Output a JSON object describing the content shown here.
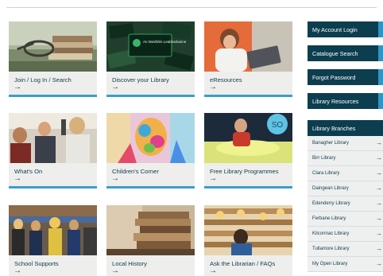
{
  "tiles": [
    {
      "label": "Join / Log In / Search",
      "arrow": "→"
    },
    {
      "label": "Discover your Library",
      "arrow": "→",
      "card_text": "An tSeirbhís Leabharlainne"
    },
    {
      "label": "eResources",
      "arrow": "→"
    },
    {
      "label": "What's On",
      "arrow": "→"
    },
    {
      "label": "Children's Corner",
      "arrow": "→"
    },
    {
      "label": "Free Library Programmes",
      "arrow": "→",
      "badge": "SO"
    },
    {
      "label": "School Supports",
      "arrow": "→"
    },
    {
      "label": "Local History",
      "arrow": "→"
    },
    {
      "label": "Ask the Librarian / FAQs",
      "arrow": "→"
    }
  ],
  "sidebar": {
    "buttons": [
      {
        "label": "My Account Login"
      },
      {
        "label": "Catalogue Search"
      },
      {
        "label": "Forgot Password"
      },
      {
        "label": "Library Resources"
      }
    ],
    "branches_title": "Library Branches",
    "branches": [
      {
        "label": "Banagher Library"
      },
      {
        "label": "Birr Library"
      },
      {
        "label": "Clara Library"
      },
      {
        "label": "Daingean Library"
      },
      {
        "label": "Edenderry Library"
      },
      {
        "label": "Ferbane Library"
      },
      {
        "label": "Kilcormac Library"
      },
      {
        "label": "Tullamore Library"
      },
      {
        "label": "My Open Library"
      }
    ],
    "branch_arrow": "→"
  },
  "colors": {
    "navy": "#0c3e4f",
    "accent": "#2f95c4",
    "tile_bar": "#3aa0c8"
  }
}
